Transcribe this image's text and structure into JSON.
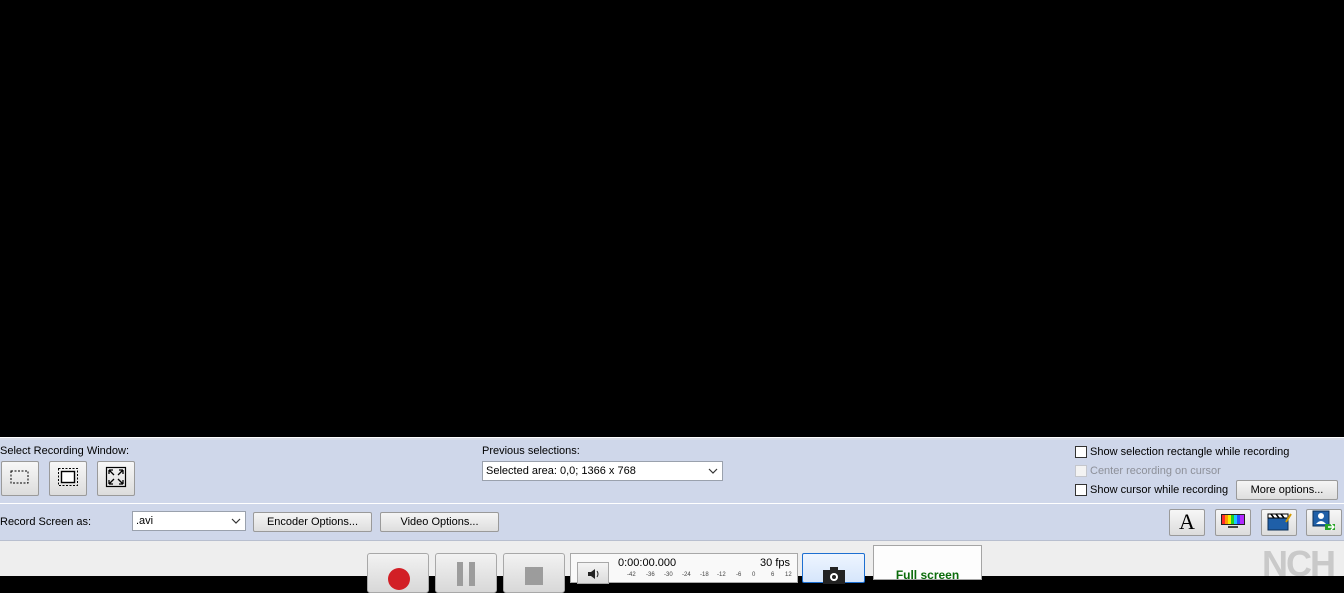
{
  "recording_window": {
    "label": "Select Recording Window:",
    "buttons": [
      {
        "name": "select-region-icon"
      },
      {
        "name": "select-window-icon"
      },
      {
        "name": "fullscreen-select-icon"
      }
    ]
  },
  "previous_selections": {
    "label": "Previous selections:",
    "value": "Selected area: 0,0; 1366 x 768"
  },
  "options": {
    "show_selection_rectangle": {
      "label": "Show selection rectangle while recording",
      "checked": false
    },
    "center_recording": {
      "label": "Center recording on cursor",
      "checked": false,
      "disabled": true
    },
    "show_cursor": {
      "label": "Show cursor while recording",
      "checked": false
    },
    "more_options_label": "More options..."
  },
  "record_as": {
    "label": "Record Screen as:",
    "format_value": ".avi",
    "encoder_options_label": "Encoder Options...",
    "video_options_label": "Video Options..."
  },
  "toolbar_icons": [
    "text-overlay-icon",
    "color-bars-icon",
    "clapperboard-icon",
    "user-export-icon"
  ],
  "status": {
    "time": "0:00:00.000",
    "fps": "30 fps",
    "scale": [
      "-42",
      "-36",
      "-30",
      "-24",
      "-18",
      "-12",
      "-6",
      "0",
      "6",
      "12"
    ]
  },
  "controls": {
    "record": "record-icon",
    "pause": "pause-icon",
    "stop": "stop-icon",
    "speaker": "speaker-icon",
    "snapshot": "camera-icon"
  },
  "mode_label": "Full screen",
  "logo_text": "NCH",
  "colors": {
    "panel": "#cfd7ea",
    "preview": "#000000",
    "record_red": "#d21f26",
    "mode_green": "#0b6b0b"
  }
}
